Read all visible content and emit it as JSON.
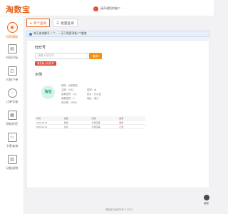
{
  "app": {
    "logo": "淘数宝",
    "top_message": "请开通您的账户"
  },
  "sidebar": {
    "items": [
      {
        "label": "旺旺照妖",
        "icon": "search-user-icon",
        "active": true
      },
      {
        "label": "旺旺打标",
        "icon": "tag-icon",
        "active": false
      },
      {
        "label": "礼物下单",
        "icon": "gift-icon",
        "active": false
      },
      {
        "label": "订单号查",
        "icon": "order-search-icon",
        "active": false
      },
      {
        "label": "隐私旺旺",
        "icon": "privacy-icon",
        "active": false
      },
      {
        "label": "卡密查询",
        "icon": "card-icon",
        "active": false
      },
      {
        "label": "功能说明",
        "icon": "document-icon",
        "active": false
      }
    ]
  },
  "tabs": [
    {
      "label": "单个查询",
      "icon": "single-query-icon",
      "active": true
    },
    {
      "label": "批量查询",
      "icon": "batch-query-icon",
      "active": false
    }
  ],
  "notice": {
    "prefix": "每天查询翻号 ",
    "highlight": "0",
    "suffix": " 个，一天只需要消耗1个额度"
  },
  "query": {
    "section_title": "旺旺号",
    "input_placeholder": "请输入旺旺号",
    "search_button": "查询",
    "tip": "请先输入旺旺号"
  },
  "result": {
    "section_title": "示例",
    "avatar_text": "淘宝",
    "info_col1": [
      "旺旺：示例旺旺",
      "注册：2012",
      "买家信誉：1心",
      "卖家信誉：0",
      "好评率：100%"
    ],
    "info_col2": [
      "性别：女",
      "实名：已认证",
      "地区：浙江"
    ],
    "table": {
      "headers": [
        "时间",
        "类型",
        "店铺",
        "结果"
      ],
      "rows": [
        [
          "2023-05-01",
          "降权",
          "示例店铺",
          "危险"
        ],
        [
          "2023-04-12",
          "打标",
          "示例店铺",
          "正常"
        ]
      ]
    }
  },
  "float_button": {
    "label": "客服",
    "icon": "service-icon"
  },
  "footer": "淘数宝 版权所有 © 2023"
}
